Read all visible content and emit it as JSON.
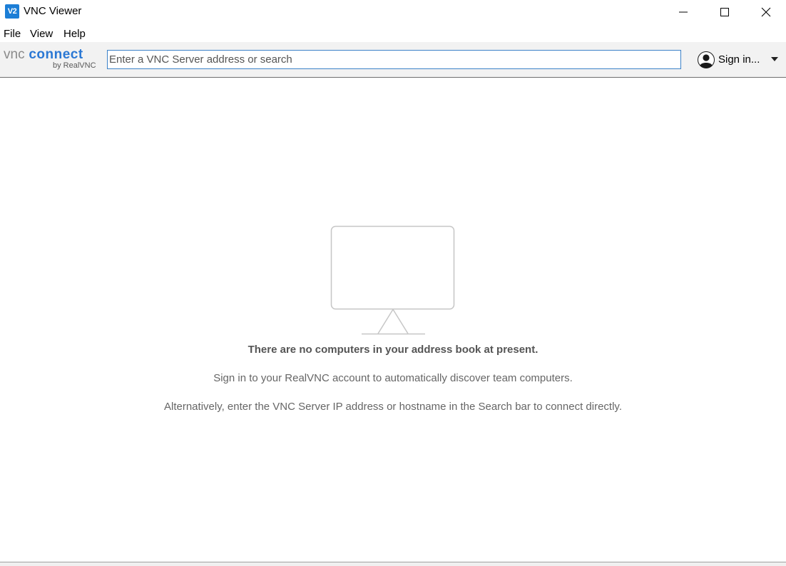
{
  "window": {
    "title": "VNC Viewer",
    "icon": "vnc-viewer-app-icon",
    "icon_text": "V2",
    "controls": [
      "minimize-icon",
      "maximize-icon",
      "close-icon"
    ]
  },
  "menu": {
    "items": [
      {
        "label": "File"
      },
      {
        "label": "View"
      },
      {
        "label": "Help"
      }
    ]
  },
  "toolbar": {
    "logo": {
      "main_vnc": "vnc",
      "main_connect": "connect",
      "sub": "by RealVNC",
      "brand_color": "#2b78d4"
    },
    "search": {
      "placeholder": "Enter a VNC Server address or search",
      "value": ""
    },
    "signin": {
      "label": "Sign in...",
      "icon": "user-avatar-icon",
      "dropdown_icon": "caret-down-icon"
    }
  },
  "main": {
    "empty_state": {
      "icon": "monitor-icon",
      "title": "There are no computers in your address book at present.",
      "line1": "Sign in to your RealVNC account to automatically discover team computers.",
      "line2": "Alternatively, enter the VNC Server IP address or hostname in the Search bar to connect directly."
    }
  }
}
